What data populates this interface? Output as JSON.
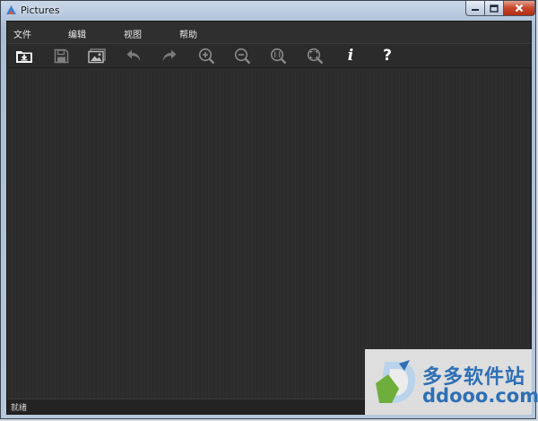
{
  "window": {
    "title": "Pictures"
  },
  "menu": {
    "items": [
      {
        "label": "文件"
      },
      {
        "label": "编辑"
      },
      {
        "label": "视图"
      },
      {
        "label": "帮助"
      }
    ]
  },
  "toolbar": {
    "tools": [
      {
        "icon": "import-icon"
      },
      {
        "icon": "save-icon"
      },
      {
        "icon": "image-icon"
      },
      {
        "icon": "undo-icon"
      },
      {
        "icon": "redo-icon"
      },
      {
        "icon": "zoom-in-icon"
      },
      {
        "icon": "zoom-out-icon"
      },
      {
        "icon": "actual-size-icon"
      },
      {
        "icon": "fit-to-window-icon"
      },
      {
        "icon": "info-icon",
        "label": "i"
      },
      {
        "icon": "help-icon",
        "label": "?"
      }
    ]
  },
  "status": {
    "text": "就绪"
  },
  "watermark": {
    "brand": "多多软件站",
    "url": "ddooo.com"
  },
  "colors": {
    "panel_background": "#2c2c2c",
    "menu_text": "#e8e8e8",
    "watermark_blue": "#2e6fb5"
  }
}
